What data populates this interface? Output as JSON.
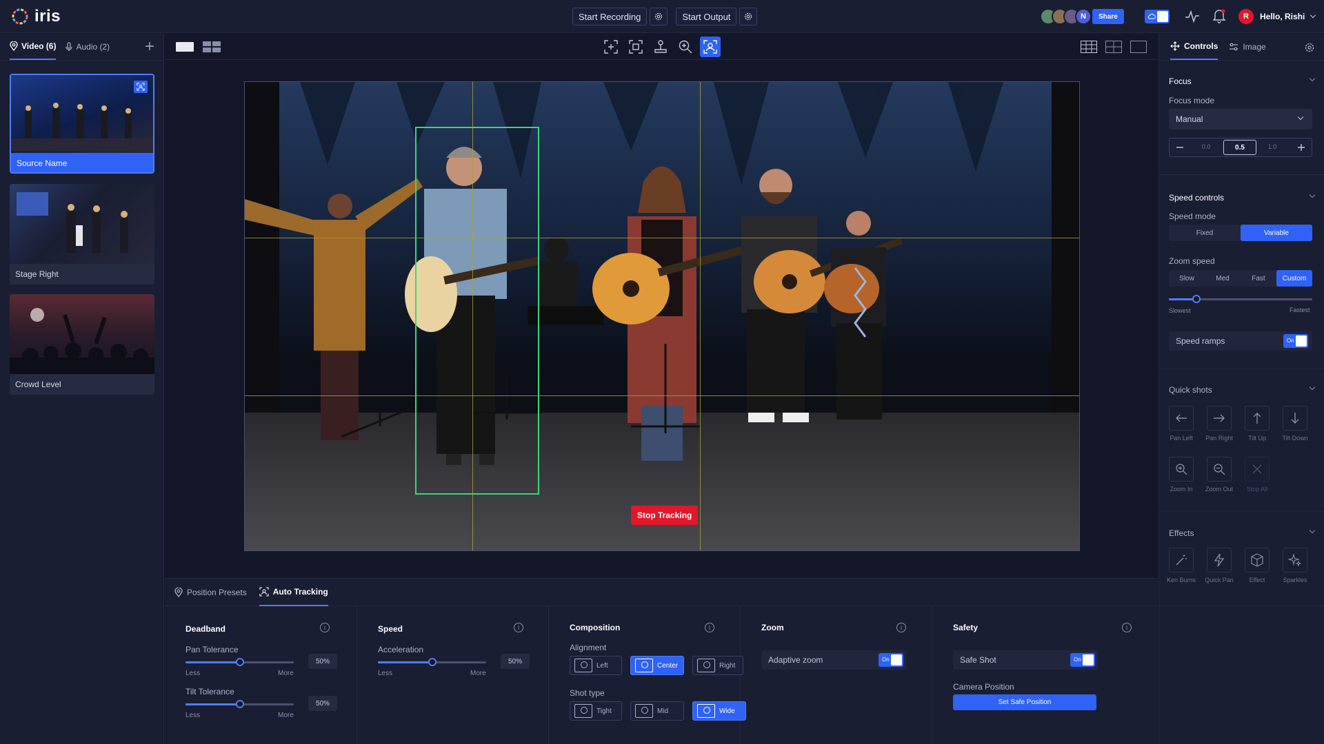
{
  "app": {
    "name": "iris"
  },
  "topbar": {
    "start_recording": "Start Recording",
    "start_output": "Start Output",
    "avatars": [
      {
        "initial": "",
        "color": "#5b8a6a"
      },
      {
        "initial": "",
        "color": "#8b6f55"
      },
      {
        "initial": "",
        "color": "#6a5b8a"
      },
      {
        "initial": "N",
        "color": "#4f5fd8"
      }
    ],
    "share": "Share",
    "user_initial": "R",
    "user_color": "#e4162a",
    "greeting": "Hello, Rishi"
  },
  "left": {
    "tabs": [
      {
        "label": "Video (6)"
      },
      {
        "label": "Audio (2)"
      }
    ],
    "sources": [
      {
        "name": "Source Name",
        "selected": true
      },
      {
        "name": "Stage Right",
        "selected": false
      },
      {
        "name": "Crowd Level",
        "selected": false
      }
    ]
  },
  "stage": {
    "stop_tracking": "Stop Tracking"
  },
  "bottom": {
    "tabs": [
      {
        "label": "Position Presets"
      },
      {
        "label": "Auto Tracking"
      }
    ],
    "deadband": {
      "title": "Deadband",
      "pan_label": "Pan Tolerance",
      "pan_value": "50%",
      "tilt_label": "Tilt Tolerance",
      "tilt_value": "50%",
      "less": "Less",
      "more": "More"
    },
    "speed": {
      "title": "Speed",
      "accel_label": "Acceleration",
      "accel_value": "50%",
      "less": "Less",
      "more": "More"
    },
    "composition": {
      "title": "Composition",
      "alignment_label": "Alignment",
      "alignment": [
        "Left",
        "Center",
        "Right"
      ],
      "shot_type_label": "Shot type",
      "shot_types": [
        "Tight",
        "Mid",
        "Wide"
      ]
    },
    "zoom": {
      "title": "Zoom",
      "adaptive_label": "Adaptive zoom",
      "adaptive_state": "On"
    },
    "safety": {
      "title": "Safety",
      "safe_shot_label": "Safe Shot",
      "safe_shot_state": "On",
      "camera_position_label": "Camera Position",
      "set_safe_position": "Set Safe Position"
    }
  },
  "right": {
    "tabs": [
      {
        "label": "Controls"
      },
      {
        "label": "Image"
      }
    ],
    "focus": {
      "title": "Focus",
      "mode_label": "Focus mode",
      "mode_value": "Manual",
      "min": "0.0",
      "value": "0.5",
      "max": "1.0"
    },
    "speed_controls": {
      "title": "Speed controls",
      "mode_label": "Speed mode",
      "modes": [
        "Fixed",
        "Variable"
      ],
      "zoom_speed_label": "Zoom speed",
      "zoom_speeds": [
        "Slow",
        "Med",
        "Fast",
        "Custom"
      ],
      "slowest": "Slowest",
      "fastest": "Fastest",
      "ramps_label": "Speed ramps",
      "ramps_state": "On"
    },
    "quick_shots": {
      "title": "Quick shots",
      "items": [
        "Pan Left",
        "Pan Right",
        "Tilt Up",
        "Tilt Down",
        "Zoom In",
        "Zoom Out",
        "Stop All"
      ]
    },
    "effects": {
      "title": "Effects",
      "items": [
        "Ken Burns",
        "Quick Pan",
        "Effect",
        "Sparkles"
      ]
    }
  },
  "colors": {
    "accent": "#2f62f5",
    "danger": "#e4162a",
    "track": "#3bd67a",
    "grid": "#a8a23a"
  }
}
